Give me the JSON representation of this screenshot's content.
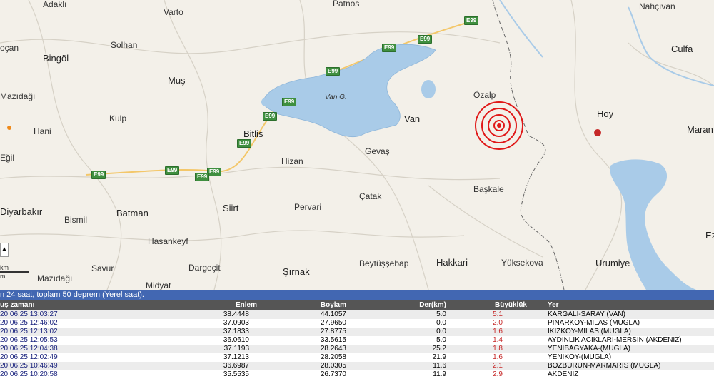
{
  "map": {
    "places": [
      {
        "id": "adakli",
        "label": "Adaklı"
      },
      {
        "id": "patnos",
        "label": "Patnos"
      },
      {
        "id": "nahcivan",
        "label": "Nahçıvan"
      },
      {
        "id": "varto",
        "label": "Varto"
      },
      {
        "id": "cocan",
        "label": "oçan"
      },
      {
        "id": "solhan",
        "label": "Solhan"
      },
      {
        "id": "bingol",
        "label": "Bingöl"
      },
      {
        "id": "culfa",
        "label": "Culfa"
      },
      {
        "id": "mazidagi",
        "label": "Mazıdağı"
      },
      {
        "id": "mus",
        "label": "Muş"
      },
      {
        "id": "ozalp",
        "label": "Özalp"
      },
      {
        "id": "vang",
        "label": "Van G."
      },
      {
        "id": "kulp",
        "label": "Kulp"
      },
      {
        "id": "van",
        "label": "Van"
      },
      {
        "id": "hoy",
        "label": "Hoy"
      },
      {
        "id": "hani",
        "label": "Hani"
      },
      {
        "id": "bitlis",
        "label": "Bitlis"
      },
      {
        "id": "maran",
        "label": "Maran"
      },
      {
        "id": "gevas",
        "label": "Gevaş"
      },
      {
        "id": "egil",
        "label": "Eğil"
      },
      {
        "id": "hizan",
        "label": "Hizan"
      },
      {
        "id": "baskale",
        "label": "Başkale"
      },
      {
        "id": "catak",
        "label": "Çatak"
      },
      {
        "id": "diyarbakir",
        "label": "Diyarbakır"
      },
      {
        "id": "batman",
        "label": "Batman"
      },
      {
        "id": "siirt",
        "label": "Siirt"
      },
      {
        "id": "pervari",
        "label": "Pervari"
      },
      {
        "id": "bismil",
        "label": "Bismil"
      },
      {
        "id": "ez",
        "label": "Ez"
      },
      {
        "id": "hasankeyf",
        "label": "Hasankeyf"
      },
      {
        "id": "dargecit",
        "label": "Dargeçit"
      },
      {
        "id": "beytussebap",
        "label": "Beytüşşebap"
      },
      {
        "id": "hakkari",
        "label": "Hakkari"
      },
      {
        "id": "yuksekova",
        "label": "Yüksekova"
      },
      {
        "id": "urumiye",
        "label": "Urumiye"
      },
      {
        "id": "savur",
        "label": "Savur"
      },
      {
        "id": "sirnak",
        "label": "Şırnak"
      },
      {
        "id": "midyat",
        "label": "Midyat"
      }
    ],
    "road_label": "E99",
    "scale": {
      "km": "km",
      "m": "m"
    }
  },
  "info_bar": "n 24 saat, toplam 50 deprem (Yerel saat).",
  "table": {
    "headers": {
      "time": "uş zamanı",
      "lat": "Enlem",
      "lon": "Boylam",
      "depth": "Der(km)",
      "mag": "Büyüklük",
      "loc": "Yer"
    },
    "rows": [
      {
        "time": "20.06.25 13:03:27",
        "lat": "38.4448",
        "lon": "44.1057",
        "depth": "5.0",
        "mag": "5.1",
        "loc": "KARGALI-SARAY (VAN)"
      },
      {
        "time": "20.06.25 12:46:02",
        "lat": "37.0903",
        "lon": "27.9650",
        "depth": "0.0",
        "mag": "2.0",
        "loc": "PINARKOY-MILAS (MUGLA)"
      },
      {
        "time": "20.06.25 12:13:02",
        "lat": "37.1833",
        "lon": "27.8775",
        "depth": "0.0",
        "mag": "1.6",
        "loc": "IKIZKOY-MILAS (MUGLA)"
      },
      {
        "time": "20.06.25 12:05:53",
        "lat": "36.0610",
        "lon": "33.5615",
        "depth": "5.0",
        "mag": "1.4",
        "loc": "AYDINLIK ACIKLARI-MERSIN (AKDENIZ)"
      },
      {
        "time": "20.06.25 12:04:38",
        "lat": "37.1193",
        "lon": "28.2643",
        "depth": "25.2",
        "mag": "1.8",
        "loc": "YENIBAGYAKA-(MUGLA)"
      },
      {
        "time": "20.06.25 12:02:49",
        "lat": "37.1213",
        "lon": "28.2058",
        "depth": "21.9",
        "mag": "1.6",
        "loc": "YENIKOY-(MUGLA)"
      },
      {
        "time": "20.06.25 10:46:49",
        "lat": "36.6987",
        "lon": "28.0305",
        "depth": "11.6",
        "mag": "2.1",
        "loc": "BOZBURUN-MARMARIS (MUGLA)"
      },
      {
        "time": "20.06.25 10:20:58",
        "lat": "35.5535",
        "lon": "26.7370",
        "depth": "11.9",
        "mag": "2.9",
        "loc": "AKDENIZ"
      }
    ]
  },
  "colors": {
    "epicenter": "#e01818",
    "header_bg": "#555555",
    "info_bg": "#4267b2",
    "lake": "#a9cbe8"
  }
}
